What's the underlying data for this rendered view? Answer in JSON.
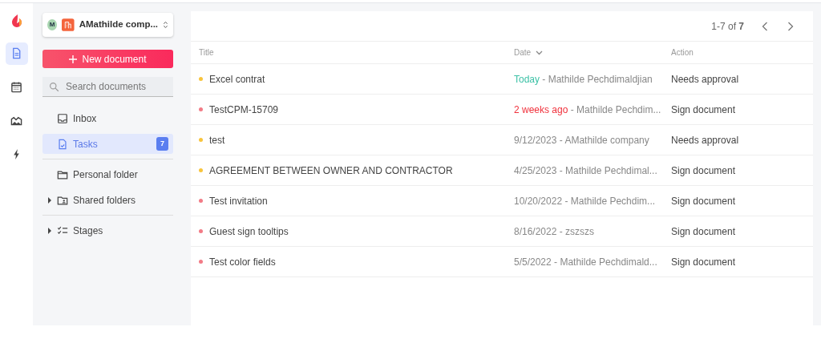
{
  "rail": [
    {
      "kind": "documents",
      "selected": true
    },
    {
      "kind": "calendar",
      "selected": false
    },
    {
      "kind": "templates",
      "selected": false
    },
    {
      "kind": "automation",
      "selected": false
    }
  ],
  "workspace": {
    "avatar": "M",
    "name": "AMathilde comp..."
  },
  "new_button": "New document",
  "search": {
    "placeholder": "Search documents"
  },
  "nav_groups": [
    [
      {
        "kind": "inbox",
        "label": "Inbox",
        "selected": false
      },
      {
        "kind": "tasks",
        "label": "Tasks",
        "selected": true,
        "badge": "7"
      }
    ],
    [
      {
        "kind": "folder",
        "label": "Personal folder",
        "selected": false
      },
      {
        "kind": "shared",
        "label": "Shared folders",
        "selected": false,
        "expanded": false
      }
    ],
    [
      {
        "kind": "stages",
        "label": "Stages",
        "selected": false,
        "expanded": false
      }
    ]
  ],
  "pagination": "1-7 of **7**",
  "table": {
    "columns": [
      "Title",
      "Date",
      "Action"
    ],
    "rows": [
      {
        "color": "#f8c43c",
        "title": "Excel contrat",
        "when": "Today",
        "kind": "recent",
        "by": " - Mathilde Pechdimaldjian",
        "action": "Needs approval"
      },
      {
        "color": "#f27b86",
        "title": "TestCPM-15709",
        "when": "2 weeks ago",
        "kind": "late",
        "by": " - Mathilde Pechdim...",
        "action": "Sign document"
      },
      {
        "color": "#f8c43c",
        "title": "test",
        "when": "9/12/2023",
        "kind": "plain",
        "by": " - AMathilde company",
        "action": "Needs approval"
      },
      {
        "color": "#f8c43c",
        "title": "AGREEMENT BETWEEN OWNER AND CONTRACTOR",
        "when": "4/25/2023",
        "kind": "plain",
        "by": " - Mathilde Pechdimal...",
        "action": "Sign document"
      },
      {
        "color": "#f27b86",
        "title": "Test invitation",
        "when": "10/20/2022",
        "kind": "plain",
        "by": " - Mathilde Pechdim...",
        "action": "Sign document"
      },
      {
        "color": "#f27b86",
        "title": "Guest sign tooltips",
        "when": "8/16/2022",
        "kind": "plain",
        "by": " - zszszs",
        "action": "Sign document"
      },
      {
        "color": "#f27b86",
        "title": "Test color fields",
        "when": "5/5/2022",
        "kind": "plain",
        "by": " - Mathilde Pechdimald...",
        "action": "Sign document"
      }
    ]
  }
}
